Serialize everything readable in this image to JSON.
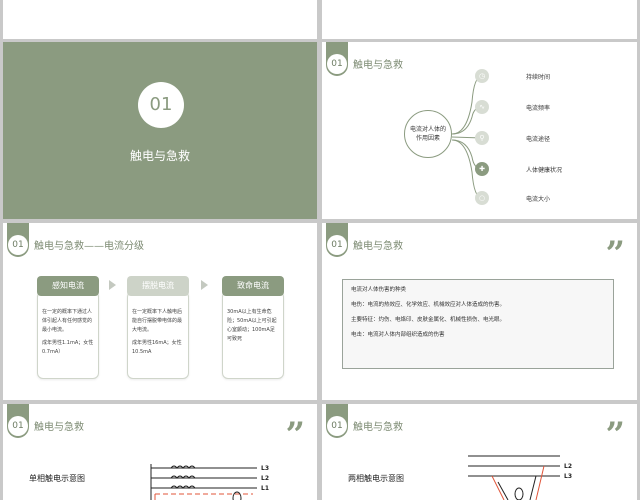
{
  "section_number": "01",
  "cover": {
    "number": "01",
    "title": "触电与急救"
  },
  "header_title": "触电与急救",
  "header_title_grading": "触电与急救——电流分级",
  "factors": {
    "center": "电流对人体的作用因素",
    "items": [
      {
        "label": "持续时间",
        "icon": "clock-icon"
      },
      {
        "label": "电流频率",
        "icon": "wave-icon"
      },
      {
        "label": "电流途径",
        "icon": "path-icon"
      },
      {
        "label": "人体健康状况",
        "icon": "health-icon"
      },
      {
        "label": "电流大小",
        "icon": "circle-icon"
      }
    ]
  },
  "grading": [
    {
      "title": "感知电流",
      "color": "#8b9b80",
      "lines": [
        "在一定的概率下通过人体引起人有任何感觉的最小电流。",
        "成年男性1.1mA；女性 0.7mA）"
      ]
    },
    {
      "title": "摆脱电流",
      "color": "#cdd3c8",
      "lines": [
        "在一定概率下人触电后能自行摆脱带电体的最大电流。",
        "成年男性16mA；女性 10.5mA"
      ]
    },
    {
      "title": "致命电流",
      "color": "#8b9b80",
      "lines": [
        "30mA以上有生命危险；50mA以上可引起心室颤动；100mA足可致死"
      ]
    }
  ],
  "damage": {
    "title": "电流对人体伤害的种类",
    "lines": [
      "电伤：电流的热效应、化学效应、机械效应对人体造成的伤害。",
      "主要特征：灼伤、电烙印、皮肤金属化、机械性损伤、电光眼。",
      "电击：电流对人体内部组织造成的伤害"
    ]
  },
  "single_phase": {
    "title": "单相触电示意图",
    "wires": [
      "L3",
      "L2",
      "L1"
    ]
  },
  "two_phase": {
    "title": "两相触电示意图",
    "wires": [
      "L2",
      "L3"
    ]
  },
  "colors": {
    "accent": "#8b9b80",
    "light": "#cdd3c8",
    "wire_red": "#e0553a"
  }
}
